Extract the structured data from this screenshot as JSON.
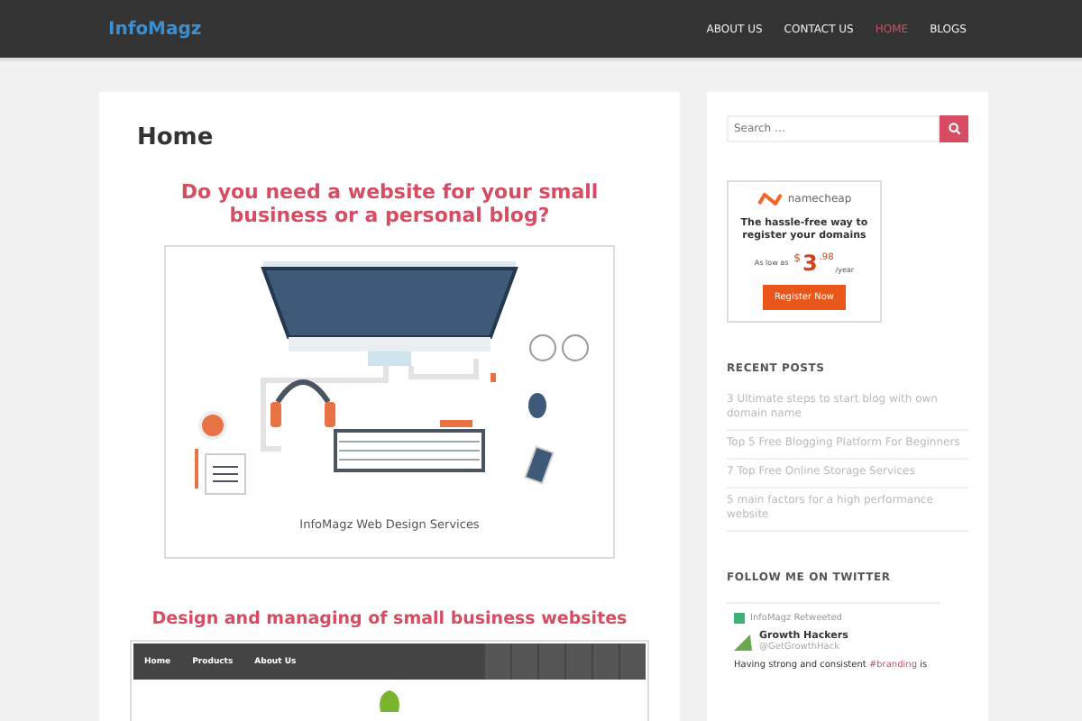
{
  "header": {
    "logo": "InfoMagz",
    "nav": [
      {
        "label": "ABOUT US",
        "selected": false
      },
      {
        "label": "CONTACT US",
        "selected": false
      },
      {
        "label": "HOME",
        "selected": true
      },
      {
        "label": "BLOGS",
        "selected": false
      }
    ]
  },
  "main": {
    "title": "Home",
    "heading": "Do you need a website for your small business or a personal blog?",
    "figure_caption": "InfoMagz Web Design Services",
    "heading_2": "Design and managing of small business websites",
    "site_preview": {
      "nav": [
        "Home",
        "Products",
        "About Us"
      ]
    }
  },
  "sidebar": {
    "search": {
      "placeholder": "Search …"
    },
    "ad": {
      "brand": "namecheap",
      "tagline": "The hassle-free way to register your domains",
      "price_prefix": "As low as",
      "currency": "$",
      "price_whole": "3",
      "price_cents": ".98",
      "price_unit": "/year",
      "button": "Register Now"
    },
    "recent_posts": {
      "title": "RECENT POSTS",
      "items": [
        "3 Ultimate steps to start blog with own domain name",
        "Top 5 Free Blogging Platform For Beginners",
        "7 Top Free Online Storage Services",
        "5 main factors for a high performance website"
      ]
    },
    "twitter": {
      "title": "FOLLOW ME ON TWITTER",
      "retweet_label": "InfoMagz Retweeted",
      "author": "Growth Hackers",
      "handle": "@GetGrowthHack",
      "text_before": "Having strong and consistent ",
      "hashtag": "#branding",
      "text_after": " is"
    }
  }
}
